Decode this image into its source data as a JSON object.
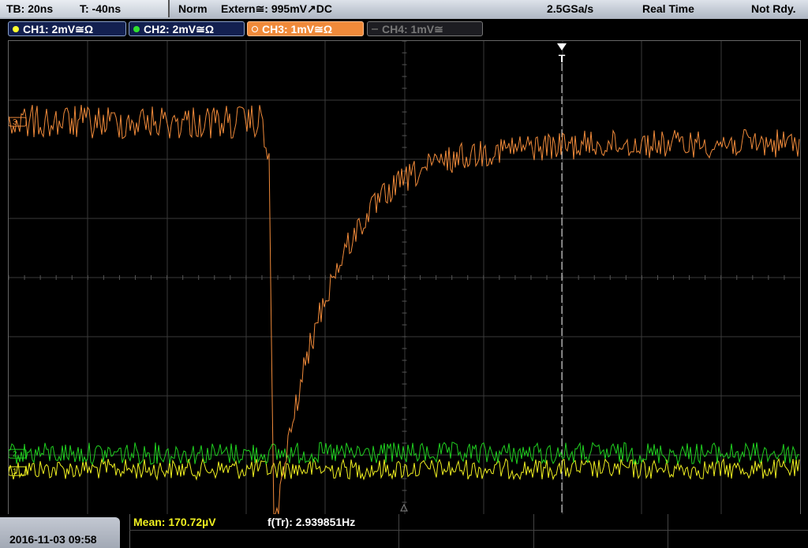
{
  "top_bar": {
    "timebase": "TB: 20ns",
    "trigger_pos": "T: -40ns",
    "trigger_mode": "Norm",
    "trigger_source": "Extern≅: 995mV↗DC",
    "sample_rate": "2.5GSa/s",
    "acq_mode": "Real Time",
    "status": "Not Rdy."
  },
  "channels": [
    {
      "label": "CH1: 2mV≅Ω",
      "color": "#ffff30",
      "active": true
    },
    {
      "label": "CH2: 2mV≅Ω",
      "color": "#30e030",
      "active": true
    },
    {
      "label": "CH3: 1mV≅Ω",
      "color": "#ffffff",
      "active": true
    },
    {
      "label": "CH4: 1mV≅",
      "color": "#666666",
      "active": false
    }
  ],
  "markers": {
    "trigger": "T",
    "ch1": "1",
    "ch2": "2",
    "ch3": "3"
  },
  "measurements": {
    "mean": "Mean: 170.72µV",
    "freq": "f(Tr): 2.939851Hz"
  },
  "datetime": "2016-11-03 09:58",
  "colors": {
    "ch1": "#f0f020",
    "ch2": "#20d020",
    "ch3": "#f08a3a",
    "grid": "#3a3a3a"
  }
}
